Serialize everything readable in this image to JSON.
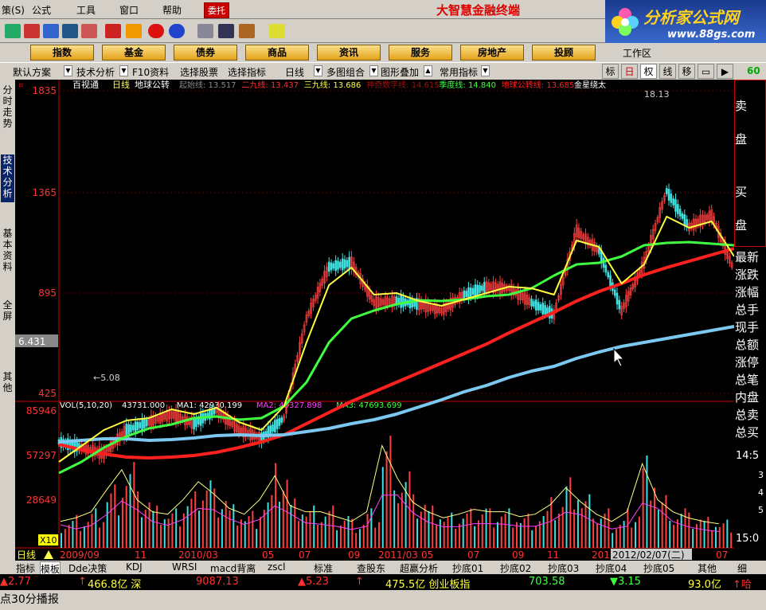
{
  "menu": {
    "items": [
      "策(S)",
      "公式",
      "工具",
      "窗口",
      "帮助"
    ],
    "entrust": "委托",
    "brand": "大智慧金融终端"
  },
  "logo": {
    "main": "分析家公式网",
    "url": "www.88gs.com"
  },
  "nav": {
    "buttons": [
      "指数",
      "基金",
      "债券",
      "商品",
      "资讯",
      "服务",
      "房地产",
      "投顾"
    ],
    "workarea": "工作区"
  },
  "subbar": {
    "items": [
      "默认方案",
      "技术分析",
      "F10资料",
      "选择股票",
      "选择指标",
      "日线",
      "多图组合",
      "图形叠加",
      "常用指标"
    ],
    "right": [
      "标",
      "日",
      "权",
      "线",
      "移"
    ],
    "right_num": "60"
  },
  "leftbar": {
    "tabs": [
      "分时走势",
      "技术分析",
      "基本资料",
      "全屏",
      "其他"
    ]
  },
  "chart_data": [
    {
      "type": "line",
      "title": "百视通",
      "period": "日线",
      "formula": "地球公转",
      "legend": [
        {
          "label": "起始线: 13.517",
          "color": "#888888"
        },
        {
          "label": "二九线: 13.437",
          "color": "#ff3030"
        },
        {
          "label": "三九线: 13.686",
          "color": "#ffff40"
        },
        {
          "label": "神奇数字线: 14.615",
          "color": "#a01010"
        },
        {
          "label": "季度线: 14.840",
          "color": "#40ff40"
        },
        {
          "label": "地球公转线: 13.685",
          "color": "#ff2020"
        },
        {
          "label": "金星绕太",
          "color": "#ffffff"
        }
      ],
      "yticks": [
        "1835",
        "1365",
        "895",
        "425"
      ],
      "current_value": "6.431",
      "low_label": "5.08",
      "high_label": "18.13",
      "x": [
        0,
        30,
        60,
        90,
        120,
        150,
        180,
        210,
        240,
        270,
        300,
        330,
        360,
        390,
        420,
        450,
        480,
        510,
        540,
        570,
        600,
        630,
        660,
        690,
        720,
        750,
        780,
        810,
        840,
        870,
        900
      ],
      "series": [
        {
          "name": "地球公转线",
          "color": "#ff2020",
          "values": [
            458,
            465,
            470,
            474,
            475,
            474,
            472,
            468,
            462,
            455,
            446,
            432,
            418,
            404,
            392,
            380,
            368,
            356,
            344,
            332,
            318,
            305,
            292,
            278,
            266,
            256,
            245,
            236,
            228,
            220,
            212
          ]
        },
        {
          "name": "起始线",
          "color": "#7cc8f0",
          "values": [
            455,
            453,
            451,
            451,
            453,
            452,
            450,
            447,
            446,
            447,
            446,
            442,
            438,
            432,
            427,
            420,
            411,
            402,
            392,
            384,
            374,
            366,
            360,
            350,
            342,
            335,
            330,
            325,
            320,
            315,
            310
          ]
        },
        {
          "name": "季度线",
          "color": "#40ff40",
          "values": [
            494,
            480,
            462,
            448,
            438,
            433,
            425,
            423,
            427,
            425,
            410,
            380,
            330,
            300,
            290,
            282,
            277,
            278,
            276,
            272,
            270,
            262,
            246,
            232,
            230,
            222,
            208,
            205,
            204,
            206,
            208
          ]
        },
        {
          "name": "三九线",
          "color": "#ffff40",
          "values": [
            480,
            460,
            440,
            428,
            425,
            414,
            420,
            412,
            430,
            440,
            410,
            330,
            258,
            236,
            270,
            268,
            278,
            284,
            276,
            268,
            260,
            262,
            270,
            202,
            210,
            256,
            232,
            172,
            186,
            178,
            222
          ]
        }
      ],
      "close": [
        455,
        462,
        470,
        440,
        430,
        420,
        432,
        415,
        440,
        450,
        425,
        300,
        235,
        230,
        280,
        278,
        282,
        290,
        270,
        260,
        262,
        280,
        295,
        190,
        215,
        290,
        230,
        140,
        185,
        170,
        240
      ]
    },
    {
      "type": "bar",
      "title": "VOL(5,10,20)",
      "legend": [
        {
          "label": "43731.000",
          "color": "#ffffff"
        },
        {
          "label": "MA1: 42930.199",
          "color": "#ffffff"
        },
        {
          "label": "MA2: 43327.898",
          "color": "#ff40ff"
        },
        {
          "label": "MA3: 47693.699",
          "color": "#40ff40"
        }
      ],
      "yticks": [
        "85946",
        "57297",
        "28649"
      ],
      "unit_label": "X10",
      "values": [
        22,
        25,
        30,
        48,
        65,
        40,
        30,
        28,
        40,
        55,
        45,
        33,
        28,
        40,
        60,
        35,
        30,
        30,
        26,
        22,
        30,
        85,
        58,
        38,
        30,
        25,
        28,
        32,
        30,
        30,
        26,
        28,
        36,
        50,
        38,
        28,
        22,
        30,
        70,
        40,
        30,
        25,
        22,
        20
      ]
    }
  ],
  "xaxis": {
    "period": "日线",
    "labels": [
      "2009/09",
      "11",
      "2010/03",
      "05",
      "07",
      "09",
      "2011/03",
      "05",
      "07",
      "09",
      "11",
      "201",
      "2012/02/07(二)",
      "07"
    ]
  },
  "rightpanel": {
    "buy_sell": [
      "卖",
      "盘",
      "买",
      "盘"
    ],
    "stats": [
      "最新",
      "涨跌",
      "涨幅",
      "总手",
      "现手",
      "总额",
      "涨停",
      "总笔",
      "内盘",
      "总卖",
      "总买"
    ],
    "times": [
      "14:5",
      "3",
      "4",
      "5",
      "15:0"
    ]
  },
  "bottomtabs": {
    "items": [
      "指标",
      "模板",
      "Dde决策",
      "KDJ",
      "WRSI",
      "macd背离",
      "zscl",
      "标准",
      "查股东",
      "超赢分析",
      "抄底01",
      "抄底02",
      "抄底03",
      "抄底04",
      "抄底05",
      "其他",
      "细"
    ],
    "active": 1
  },
  "ticker": {
    "items": [
      {
        "text": "▲2.77",
        "color": "#ff3030"
      },
      {
        "text": "↑",
        "color": "#ff3030"
      },
      {
        "text": "466.8亿 深",
        "color": "#ffff40"
      },
      {
        "text": "9087.13",
        "color": "#ff3030"
      },
      {
        "text": "▲5.23",
        "color": "#ff3030"
      },
      {
        "text": "↑",
        "color": "#ff3030"
      },
      {
        "text": "475.5亿 创业板指",
        "color": "#ffff40"
      },
      {
        "text": "703.58",
        "color": "#40ff40"
      },
      {
        "text": "▼3.15",
        "color": "#40ff40"
      },
      {
        "text": "93.0亿",
        "color": "#ffff40"
      },
      {
        "text": "↑哈",
        "color": "#ff3030"
      }
    ]
  },
  "status": {
    "text": "点30分播报"
  }
}
